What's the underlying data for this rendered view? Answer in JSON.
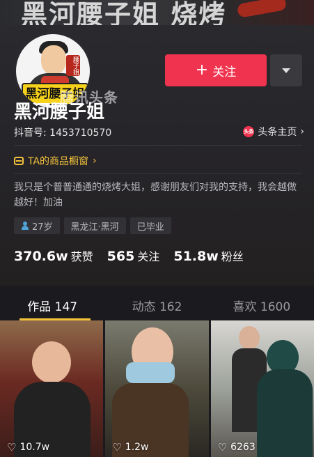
{
  "banner": {
    "text": "黑河腰子姐 烧烤"
  },
  "avatar": {
    "sign_text": "黑河腰子姐",
    "side_tag": "腰子姐"
  },
  "watermark": "腾讯头条",
  "follow_button": {
    "label": "关注",
    "icon": "plus-icon"
  },
  "more_button": {
    "icon": "triangle-down-icon"
  },
  "profile": {
    "name": "黑河腰子姐",
    "douyin_id": "抖音号: 1453710570",
    "toutiao_link": "头条主页",
    "toutiao_logo_text": "头条",
    "shop_link": "TA的商品橱窗",
    "bio": "我只是个普普通通的烧烤大姐，感谢朋友们对我的支持，我会越做越好！加油",
    "tags": {
      "age": "27岁",
      "location": "黑龙江·黑河",
      "status": "已毕业"
    }
  },
  "stats": {
    "likes_num": "370.6w",
    "likes_label": "获赞",
    "following_num": "565",
    "following_label": "关注",
    "fans_num": "51.8w",
    "fans_label": "粉丝"
  },
  "tabs": [
    {
      "label": "作品 147",
      "active": true
    },
    {
      "label": "动态 162",
      "active": false
    },
    {
      "label": "喜欢 1600",
      "active": false
    }
  ],
  "videos": [
    {
      "likes": "10.7w"
    },
    {
      "likes": "1.2w"
    },
    {
      "likes": "6263"
    }
  ],
  "colors": {
    "accent": "#f0334e",
    "highlight": "#f5c33b",
    "background": "#1b1a1f"
  }
}
